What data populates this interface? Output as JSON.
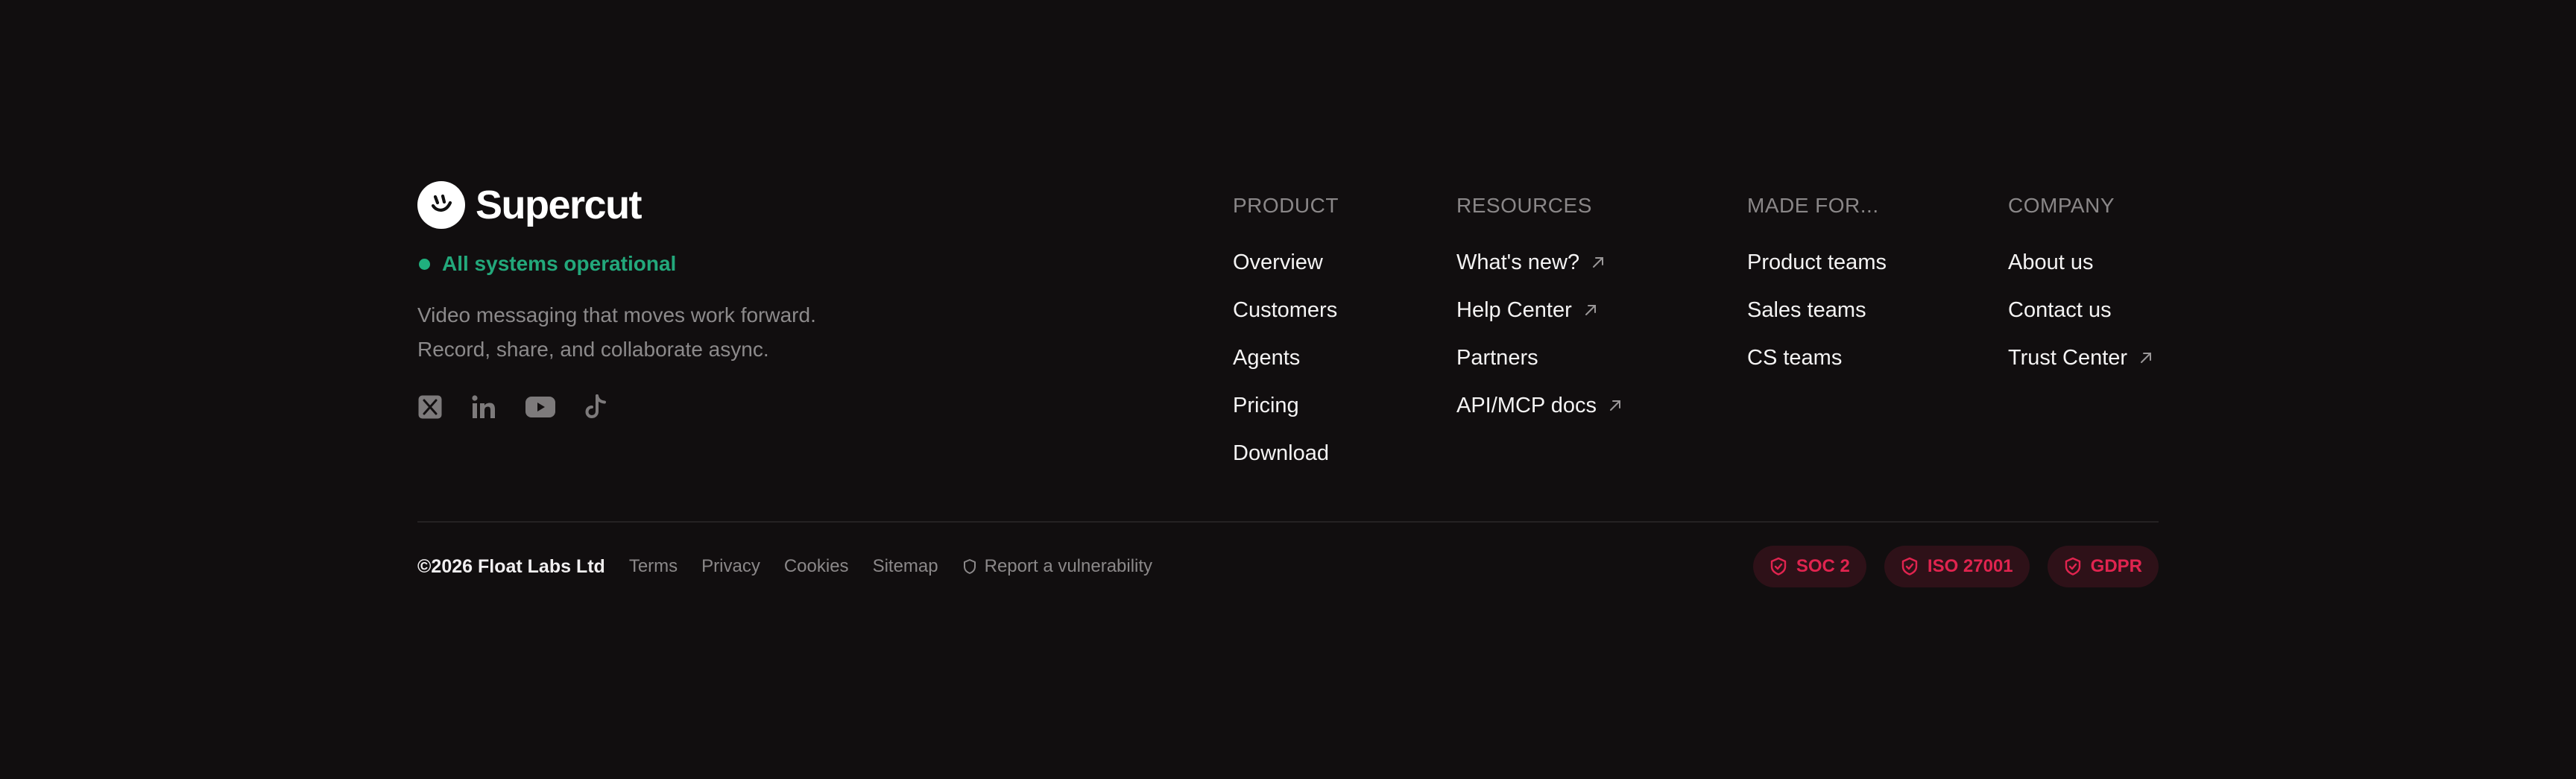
{
  "brand": {
    "name": "Supercut",
    "logo_icon": "smile-face-icon",
    "status": "All systems operational",
    "status_color": "#23a87b",
    "tagline_line1": "Video messaging that moves work forward.",
    "tagline_line2": "Record, share, and collaborate async.",
    "socials": [
      {
        "icon": "x-twitter-icon"
      },
      {
        "icon": "linkedin-icon"
      },
      {
        "icon": "youtube-icon"
      },
      {
        "icon": "tiktok-icon"
      }
    ]
  },
  "columns": [
    {
      "heading": "PRODUCT",
      "links": [
        {
          "label": "Overview"
        },
        {
          "label": "Customers"
        },
        {
          "label": "Agents"
        },
        {
          "label": "Pricing"
        },
        {
          "label": "Download"
        }
      ]
    },
    {
      "heading": "RESOURCES",
      "links": [
        {
          "label": "What's new?",
          "external": true
        },
        {
          "label": "Help Center",
          "external": true
        },
        {
          "label": "Partners"
        },
        {
          "label": "API/MCP docs",
          "external": true
        }
      ]
    },
    {
      "heading": "MADE FOR...",
      "links": [
        {
          "label": "Product teams"
        },
        {
          "label": "Sales teams"
        },
        {
          "label": "CS teams"
        }
      ]
    },
    {
      "heading": "COMPANY",
      "links": [
        {
          "label": "About us"
        },
        {
          "label": "Contact us"
        },
        {
          "label": "Trust Center",
          "external": true
        }
      ]
    }
  ],
  "bottom": {
    "copyright": "©2026 Float Labs Ltd",
    "links": [
      "Terms",
      "Privacy",
      "Cookies",
      "Sitemap"
    ],
    "report": "Report a vulnerability",
    "badges": [
      "SOC 2",
      "ISO 27001",
      "GDPR"
    ],
    "badge_color": "#e0244f"
  }
}
